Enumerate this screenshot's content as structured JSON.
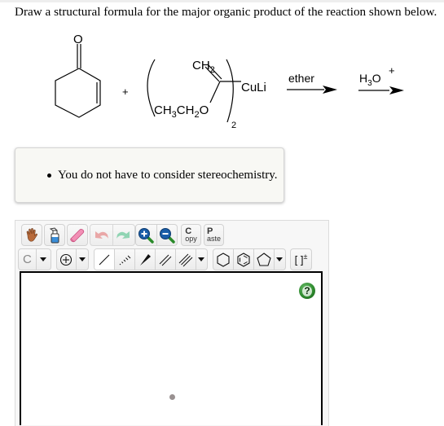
{
  "question": {
    "text": "Draw a structural formula for the major organic product of the reaction shown below."
  },
  "reaction": {
    "reactant1": {
      "name": "2-cyclohexen-1-one",
      "atom_label": "O"
    },
    "plus": "+",
    "reactant2": {
      "ch2": "CH",
      "ch2_sub": "2",
      "ethoxy_parts": [
        "CH",
        "3",
        "CH",
        "2",
        "O"
      ],
      "reagent": "-CuLi",
      "subscript": "2"
    },
    "step1": {
      "label": "ether"
    },
    "step2": {
      "label": "H",
      "label_sub": "3",
      "label_rest": "O",
      "charge": "+"
    }
  },
  "hints": [
    "You do not have to consider stereochemistry."
  ],
  "editor": {
    "toolbar_row1": [
      {
        "name": "move-tool",
        "icon": "hand-icon"
      },
      {
        "name": "clean-tool",
        "icon": "spray-bottle-icon"
      },
      {
        "name": "erase-tool",
        "icon": "eraser-icon"
      },
      {
        "name": "undo",
        "icon": "undo-arrow-icon"
      },
      {
        "name": "redo",
        "icon": "redo-arrow-icon"
      },
      {
        "name": "zoom-in",
        "icon": "zoom-in-icon"
      },
      {
        "name": "zoom-out",
        "icon": "zoom-out-icon"
      },
      {
        "name": "copy",
        "big": "C",
        "small": "opy"
      },
      {
        "name": "paste",
        "big": "P",
        "small": "aste"
      }
    ],
    "atom_selector": "C",
    "toolbar_row2": [
      "single-bond",
      "hashed-bond",
      "wedge-bond",
      "double-bond",
      "triple-bond",
      "cyclohexane",
      "benzene",
      "cyclopentane",
      "bracket-charge"
    ],
    "bracket_label": "[ ]",
    "bracket_sup": "±",
    "help_label": "?",
    "colors": {
      "help_green": "#2e8b2e",
      "zoom_blue": "#1a5ea8",
      "eraser_pink": "#f06fa0",
      "undo_red": "#e08585",
      "redo_green": "#6cc59a"
    }
  }
}
